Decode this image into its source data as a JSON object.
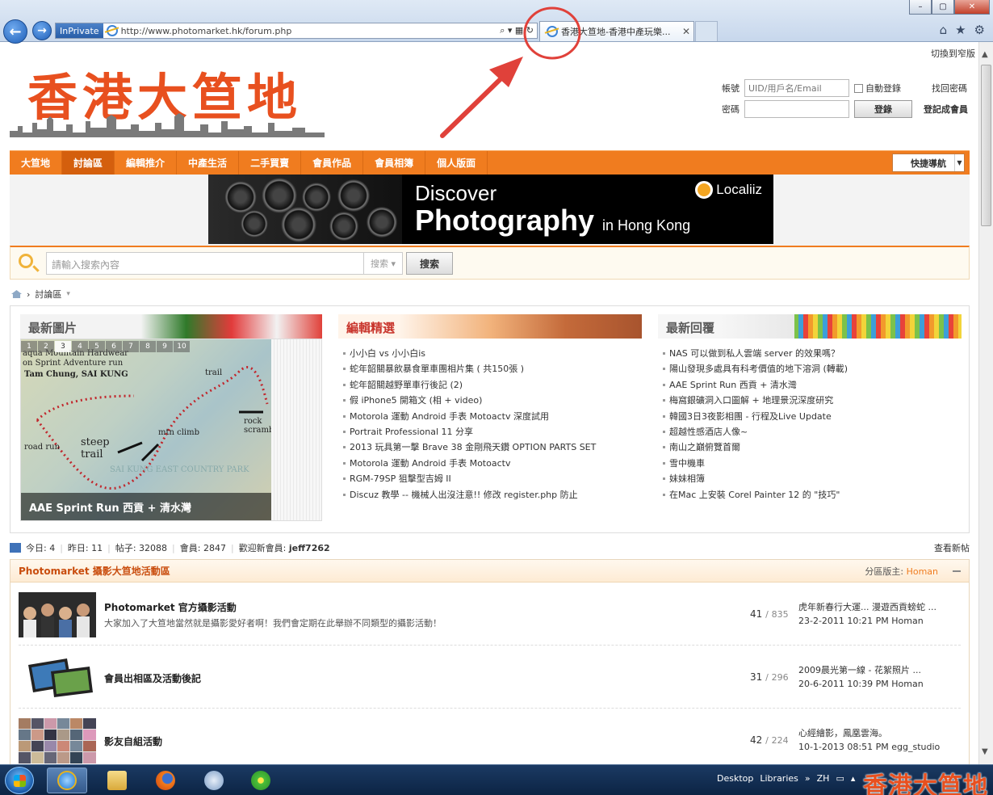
{
  "browser": {
    "inprivate": "InPrivate",
    "url": "http://www.photomarket.hk/forum.php",
    "tab_title": "香港大笪地-香港中產玩樂...",
    "window_controls": [
      "–",
      "▢",
      "✕"
    ]
  },
  "page": {
    "top_link": "切換到窄版",
    "logo_text": "香港大笪地",
    "login": {
      "account_label": "帳號",
      "account_placeholder": "UID/用戶名/Email",
      "auto_login": "自動登錄",
      "forgot": "找回密碼",
      "password_label": "密碼",
      "login_button": "登錄",
      "register": "登記成會員"
    },
    "nav": [
      "大笪地",
      "討論區",
      "編輯推介",
      "中產生活",
      "二手買賣",
      "會員作品",
      "會員相簿",
      "個人版面"
    ],
    "nav_active_index": 1,
    "quick_nav": "快捷導航",
    "banner": {
      "line1": "Discover",
      "line2": "Photography",
      "line2_suffix": "in Hong Kong",
      "brand": "Localiiz"
    },
    "search": {
      "placeholder": "請輸入搜索內容",
      "type": "搜索",
      "button": "搜索"
    },
    "breadcrumb": "討論區",
    "portal": {
      "latest_images": {
        "title": "最新圖片",
        "pager": [
          "1",
          "2",
          "3",
          "4",
          "5",
          "6",
          "7",
          "8",
          "9",
          "10"
        ],
        "pager_active": 2,
        "map_labels": [
          "aqua Mountain Hardwear",
          "on Sprint Adventure run",
          "Tam Chung, SAI KUNG",
          "trail",
          "rock scramb",
          "mtn climb",
          "steep trail",
          "road run",
          "SAI KUNG EAST COUNTRY PARK"
        ],
        "caption": "AAE Sprint Run 西貢 + 清水灣"
      },
      "editor_picks": {
        "title": "編輯精選",
        "items": [
          "小小白 vs 小小白is",
          "蛇年韶關暴飲暴食單車團相片集 ( 共150張 )",
          "蛇年韶關越野單車行後記 (2)",
          "假 iPhone5 開箱文 (相 + video)",
          "Motorola 運動 Android 手表 Motoactv 深度試用",
          "Portrait Professional 11 分享",
          "2013 玩具第一擊 Brave 38 金剛飛天鑽 OPTION PARTS SET",
          "Motorola 運動 Android 手表 Motoactv",
          "RGM-79SP 狙擊型吉姆 II",
          "Discuz 教學 -- 機械人出沒注意!! 修改 register.php 防止"
        ]
      },
      "latest_replies": {
        "title": "最新回覆",
        "items": [
          "NAS 可以做到私人雲端 server 的效果嗎？",
          "陽山發現多處具有科考價值的地下溶洞 (轉載)",
          "AAE Sprint Run 西貢 + 清水灣",
          "梅窩銀礦洞入口圖解 + 地理景況深度研究",
          "韓國3日3夜影相團 - 行程及Live Update",
          "超越性感酒店人像~",
          "南山之巔俯覽首爾",
          "雪中機車",
          "妹妹相簿",
          "在Mac 上安裝 Corel Painter 12 的 \"技巧\""
        ]
      }
    },
    "stats": {
      "today": "今日: 4",
      "yesterday": "昨日: 11",
      "posts": "帖子: 32088",
      "members": "會員: 2847",
      "welcome": "歡迎新會員:",
      "new_member": "jeff7262",
      "view_new": "查看新帖"
    },
    "forum": {
      "title": "Photomarket 攝影大笪地活動區",
      "moderator_label": "分區版主:",
      "moderator": "Homan",
      "rows": [
        {
          "name": "Photomarket 官方攝影活動",
          "desc": "大家加入了大笪地當然就是攝影愛好者啊！我們會定期在此舉辦不同類型的攝影活動！",
          "threads": "41",
          "posts": "835",
          "last_title": "虎年新春行大運... 漫遊西貢螃蛇 ...",
          "last_meta": "23-2-2011 10:21 PM Homan"
        },
        {
          "name": "會員出相區及活動後記",
          "desc": "",
          "threads": "31",
          "posts": "296",
          "last_title": "2009晨光第一線 - 花絮照片 ...",
          "last_meta": "20-6-2011 10:39 PM Homan"
        },
        {
          "name": "影友自組活動",
          "desc": "",
          "threads": "42",
          "posts": "224",
          "last_title": "心經繪影，鳳凰雲海。",
          "last_meta": "10-1-2013 08:51 PM egg_studio"
        }
      ]
    }
  },
  "taskbar": {
    "desktop": "Desktop",
    "libraries": "Libraries",
    "lang": "ZH",
    "watermark": "香港大笪地"
  },
  "colors": {
    "nav_orange": "#f07c1f",
    "logo_orange": "#e8501f",
    "annotation_red": "#e0413a"
  },
  "icons": [
    "back-arrow-icon",
    "forward-arrow-icon",
    "ie-page-icon",
    "search-icon",
    "refresh-icon",
    "home-icon",
    "star-icon",
    "gear-icon",
    "chart-icon",
    "collapse-icon"
  ]
}
